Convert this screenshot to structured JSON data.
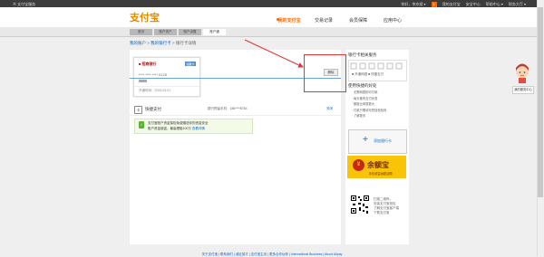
{
  "topbar": {
    "left": "▣ 支付宝服务",
    "items": [
      "你好，李亦斌 ▾",
      "消 1 ▾",
      "我的支付宝",
      "安全中心",
      "帮助中心 ▾",
      "财务大厅 ▾"
    ],
    "badge": "1"
  },
  "header": {
    "logo": "支付宝",
    "nav": [
      "我的支付宝",
      "交易记录",
      "会员保障",
      "应用中心"
    ],
    "subnav": [
      "首页",
      "账户资产",
      "账户设置",
      "账户通"
    ]
  },
  "breadcrumb": {
    "home": "我的账户",
    "parent": "我的银行卡",
    "sep": ">",
    "current": "银行卡详情"
  },
  "card": {
    "bank": "■ 招商银行",
    "badge": "储蓄卡",
    "number": "**** **** **** 0125",
    "footer": "开通时间：2015.03.01"
  },
  "edit_button": "删除",
  "quickpay": {
    "icon": "卡",
    "title": "快捷支付",
    "phone": "银行预留手机：186****8784",
    "close": "关闭",
    "line1": "支付宝账户资金保险免费赠送你的资金安全",
    "line2": "账户资金被盗，最高理赔100万",
    "link": "查看详情"
  },
  "side": {
    "title": "银行卡相关服务",
    "boxtext": "■ 开通网银 ■ 快捷支付",
    "title2": "使用快捷的好处",
    "list": [
      "· 无需网银即可付款",
      "· 每天都有支付优惠",
      "· 额度比网银更大",
      "· 付款只需填写短信校验码",
      "· 了解更多"
    ],
    "add": "添加银行卡"
  },
  "ad": {
    "circle": "¥",
    "title": "余额宝",
    "sub": "年化收益远超活期"
  },
  "qr": {
    "lines": [
      "扫描二维码，",
      "安装支付宝钱包",
      "",
      "了解支付宝客户端",
      "下载支付宝"
    ]
  },
  "service_button": "我的服务中心",
  "footer": "关于支付宝 | 联系我们 | 诚征英才 | 支付宝主页 | 更多合作伙伴 | International Business | About Alipay"
}
